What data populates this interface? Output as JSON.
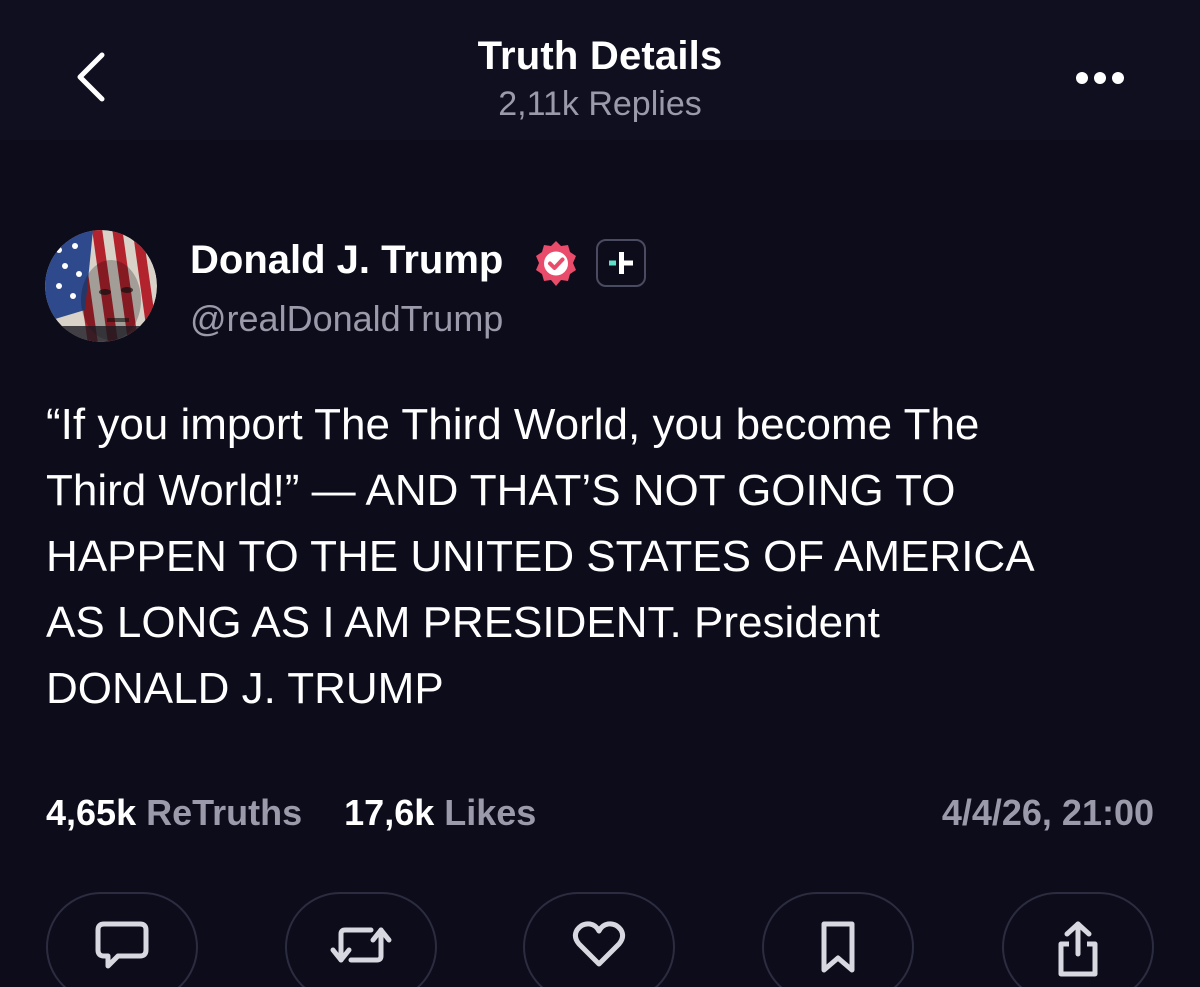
{
  "header": {
    "title": "Truth Details",
    "subtitle": "2,11k Replies"
  },
  "author": {
    "name": "Donald J. Trump",
    "handle": "@realDonaldTrump"
  },
  "post": {
    "text": "“If you import The Third World, you become The\nThird World!” — AND THAT’S NOT GOING TO\nHAPPEN TO THE UNITED STATES OF AMERICA\nAS LONG AS I AM PRESIDENT. President\nDONALD J. TRUMP"
  },
  "stats": {
    "retruths_count": "4,65k",
    "retruths_label": "ReTruths",
    "likes_count": "17,6k",
    "likes_label": "Likes",
    "timestamp": "4/4/26, 21:00"
  },
  "actions": [
    {
      "icon": "reply-icon"
    },
    {
      "icon": "retruth-icon"
    },
    {
      "icon": "heart-icon"
    },
    {
      "icon": "bookmark-icon"
    },
    {
      "icon": "share-icon"
    }
  ],
  "colors": {
    "background": "#0c0c1b",
    "header_background": "#0f0f20",
    "muted_text": "#9a9aab",
    "verified_badge": "#e94b6a",
    "plus_badge_accent": "#5fe0c8"
  }
}
